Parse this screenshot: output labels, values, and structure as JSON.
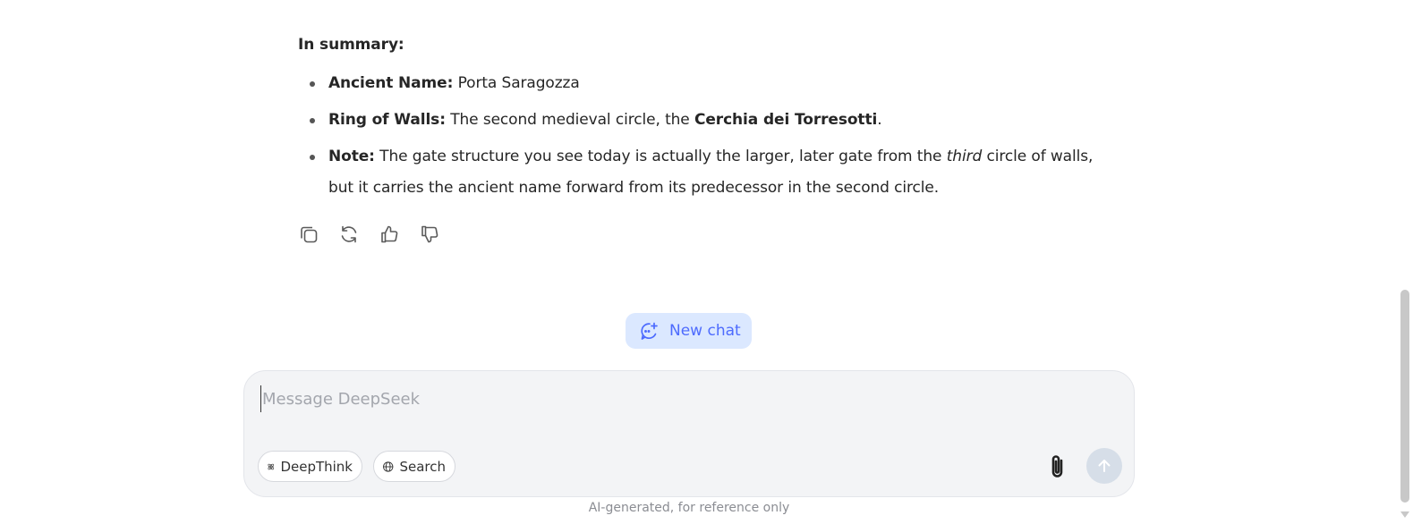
{
  "answer": {
    "summary_heading": "In summary:",
    "bullets": [
      {
        "label": "Ancient Name:",
        "text": " Porta Saragozza"
      },
      {
        "label": "Ring of Walls:",
        "text_before": " The second medieval circle, the ",
        "bold": "Cerchia dei Torresotti",
        "text_after": "."
      },
      {
        "label": "Note:",
        "text_before": " The gate structure you see today is actually the larger, later gate from the ",
        "italic": "third",
        "text_after": " circle of walls, but it carries the ancient name forward from its predecessor in the second circle."
      }
    ]
  },
  "actions": {
    "icons": [
      "copy-icon",
      "regenerate-icon",
      "thumbs-up-icon",
      "thumbs-down-icon"
    ]
  },
  "new_chat": {
    "label": "New chat"
  },
  "composer": {
    "placeholder": "Message DeepSeek",
    "deepthink_label": "DeepThink",
    "search_label": "Search"
  },
  "footer": {
    "disclaimer": "AI-generated, for reference only"
  },
  "colors": {
    "accent": "#4d6bfe",
    "new_chat_bg": "#dbe8ff",
    "composer_bg": "#f3f4f6",
    "send_disabled": "#d6dee8"
  }
}
